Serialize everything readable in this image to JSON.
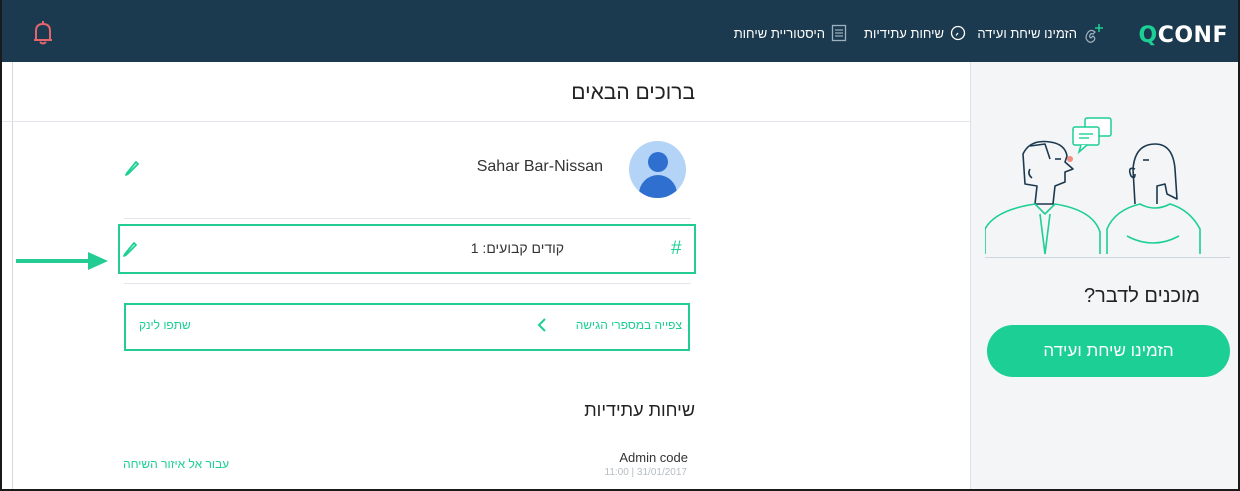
{
  "colors": {
    "topbar": "#1c3a4f",
    "accent": "#1ccf94",
    "highlight": "#23cc93",
    "bell": "#e4656d"
  },
  "brand": {
    "q": "Q",
    "rest": "CONF"
  },
  "nav": {
    "book_call": {
      "label": "הזמינו שיחת ועידה",
      "icon": "phone-plus-icon"
    },
    "future_calls": {
      "label": "שיחות עתידיות",
      "icon": "clock-icon"
    },
    "call_history": {
      "label": "היסטוריית שיחות",
      "icon": "document-icon"
    },
    "notifications_icon": "bell-icon"
  },
  "main": {
    "welcome": "ברוכים הבאים",
    "user_name": "Sahar Bar-Nissan",
    "fixed_codes": "קודים קבועים: 1",
    "view_numbers": "צפייה במספרי הגישה",
    "share_link": "שתפו לינק",
    "future_calls_title": "שיחות עתידיות",
    "call": {
      "name": "Admin code",
      "time": "11:00 | 31/01/2017",
      "go_label": "עבור אל איזור השיחה"
    }
  },
  "sidebar": {
    "ready_text": "מוכנים לדבר?",
    "book_button": "הזמינו שיחת ועידה"
  }
}
